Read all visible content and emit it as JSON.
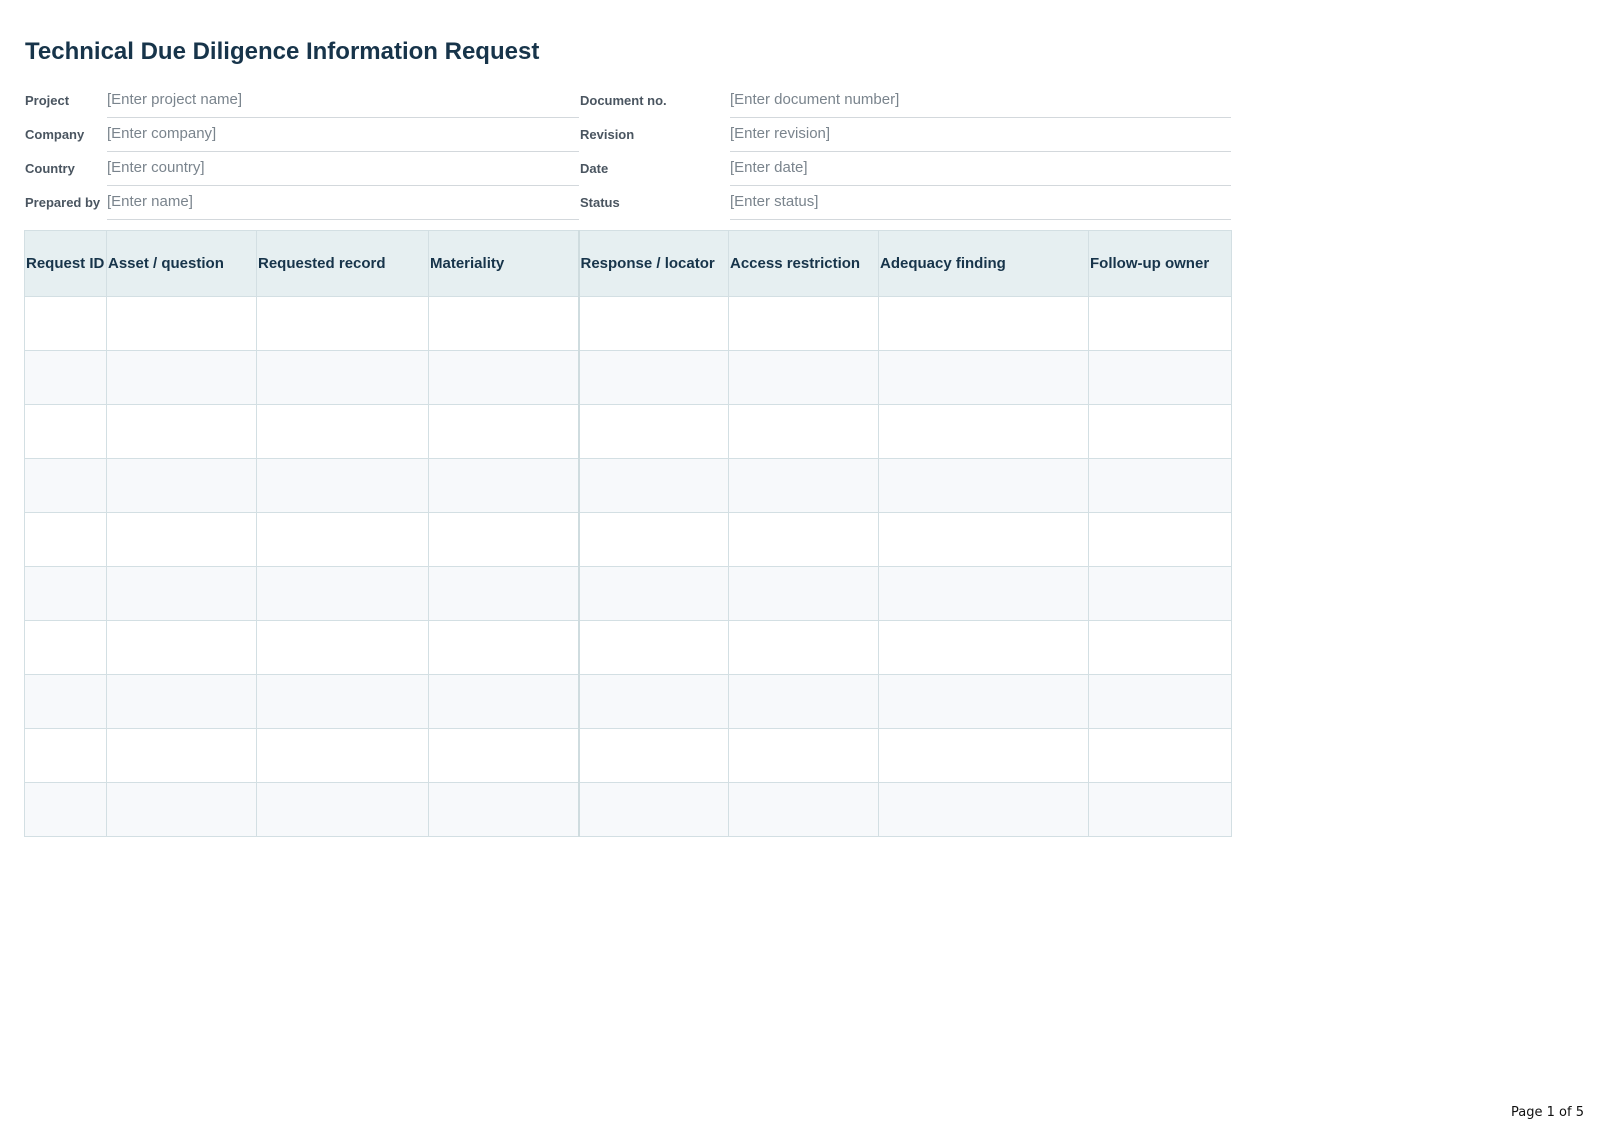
{
  "document": {
    "title": "Technical Due Diligence Information Request",
    "page_label": "Page 1 of 5"
  },
  "meta": {
    "left": [
      {
        "label": "Project",
        "value": "[Enter project name]"
      },
      {
        "label": "Company",
        "value": "[Enter company]"
      },
      {
        "label": "Country",
        "value": "[Enter country]"
      },
      {
        "label": "Prepared by",
        "value": "[Enter name]"
      }
    ],
    "right": [
      {
        "label": "Document no.",
        "value": "[Enter document number]"
      },
      {
        "label": "Revision",
        "value": "[Enter revision]"
      },
      {
        "label": "Date",
        "value": "[Enter date]"
      },
      {
        "label": "Status",
        "value": "[Enter status]"
      }
    ]
  },
  "table": {
    "columns": [
      "Request ID",
      "Asset / question",
      "Requested record",
      "Materiality",
      "Response / locator",
      "Access restriction",
      "Adequacy finding",
      "Follow-up owner"
    ],
    "rows": [
      [
        "",
        "",
        "",
        "",
        "",
        "",
        "",
        ""
      ],
      [
        "",
        "",
        "",
        "",
        "",
        "",
        "",
        ""
      ],
      [
        "",
        "",
        "",
        "",
        "",
        "",
        "",
        ""
      ],
      [
        "",
        "",
        "",
        "",
        "",
        "",
        "",
        ""
      ],
      [
        "",
        "",
        "",
        "",
        "",
        "",
        "",
        ""
      ],
      [
        "",
        "",
        "",
        "",
        "",
        "",
        "",
        ""
      ],
      [
        "",
        "",
        "",
        "",
        "",
        "",
        "",
        ""
      ],
      [
        "",
        "",
        "",
        "",
        "",
        "",
        "",
        ""
      ],
      [
        "",
        "",
        "",
        "",
        "",
        "",
        "",
        ""
      ],
      [
        "",
        "",
        "",
        "",
        "",
        "",
        "",
        ""
      ]
    ]
  }
}
